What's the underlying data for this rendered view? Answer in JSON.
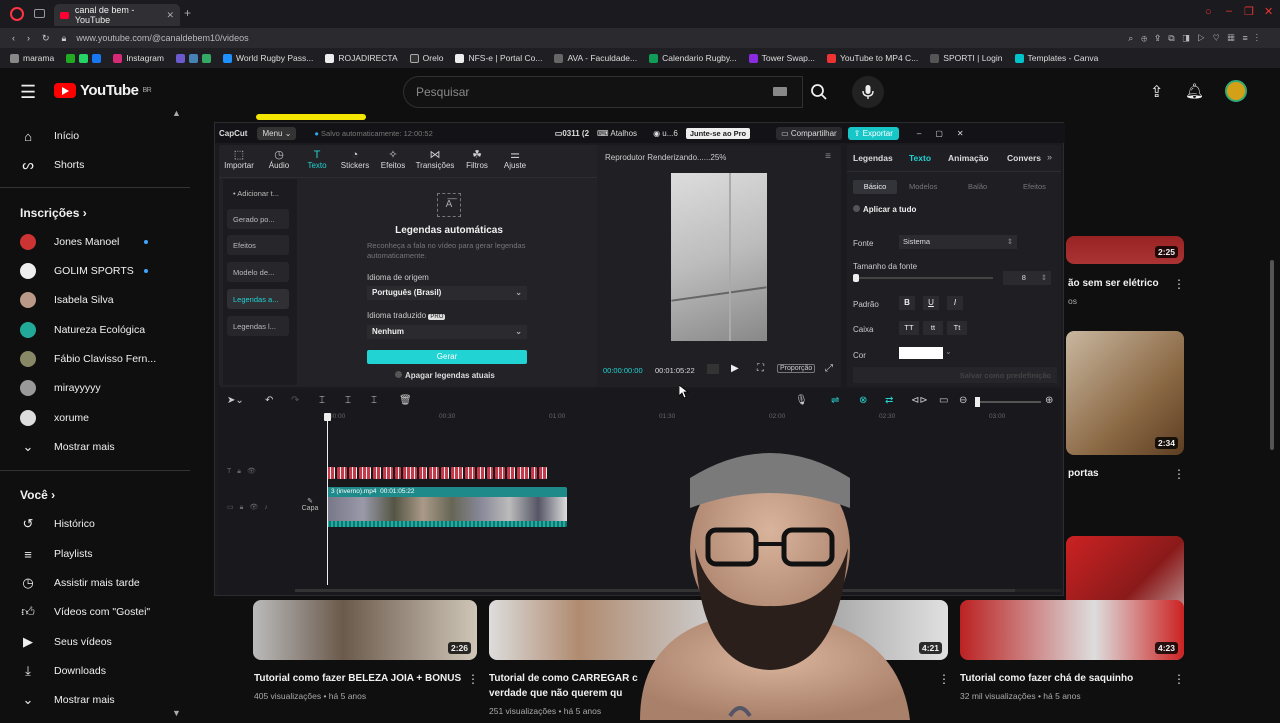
{
  "browser": {
    "tab_title": "canal de bem - YouTube",
    "url": "www.youtube.com/@canaldebem10/videos",
    "bookmarks": [
      "marama",
      "Instagram",
      "World Rugby Pass...",
      "ROJADIRECTA",
      "Orelo",
      "NFS-e | Portal Co...",
      "AVA - Faculdade...",
      "Calendario Rugby...",
      "Tower Swap...",
      "YouTube to MP4 C...",
      "SPORTI | Login",
      "Templates - Canva"
    ]
  },
  "youtube": {
    "logo": "YouTube",
    "region": "BR",
    "search_placeholder": "Pesquisar",
    "nav": {
      "home": "Início",
      "shorts": "Shorts"
    },
    "subs_header": "Inscrições",
    "subs": [
      "Jones Manoel",
      "GOLIM SPORTS",
      "Isabela Silva",
      "Natureza Ecológica",
      "Fábio Clavisso Fern...",
      "mirayyyyy",
      "xorume",
      "Mostrar mais"
    ],
    "you_header": "Você",
    "you": [
      "Histórico",
      "Playlists",
      "Assistir mais tarde",
      "Vídeos com \"Gostei\"",
      "Seus vídeos",
      "Downloads",
      "Mostrar mais"
    ],
    "videos": [
      {
        "title": "Tutorial como fazer BELEZA JOIA + BONUS",
        "meta": "405 visualizações • há 5 anos",
        "duration": "2:26"
      },
      {
        "title": "Tutorial de como CARREGAR c",
        "title2": "verdade que não querem qu",
        "meta": "251 visualizações • há 5 anos",
        "duration": ""
      },
      {
        "title": "",
        "meta": "",
        "duration": "4:21"
      },
      {
        "title": "Tutorial como fazer chá de saquinho",
        "meta": "32 mil visualizações • há 5 anos",
        "duration": "4:23"
      },
      {
        "title": "ão sem ser elétrico",
        "meta": "os",
        "duration": "2:25"
      },
      {
        "title": "portas",
        "meta": "",
        "duration": "2:34"
      }
    ]
  },
  "capcut": {
    "app": "CapCut",
    "menu": "Menu",
    "autosave": "Salvo automaticamente: 12:00:52",
    "project": "0311 (2",
    "shortcuts": "Atalhos",
    "user": "u...6",
    "pro": "Junte-se ao Pro",
    "share": "Compartilhar",
    "export": "Exportar",
    "tools": [
      "Importar",
      "Áudio",
      "Texto",
      "Stickers",
      "Efeitos",
      "Transições",
      "Filtros",
      "Ajuste"
    ],
    "side": [
      "• Adicionar t...",
      "Gerado po...",
      "Efeitos",
      "Modelo de...",
      "Legendas a...",
      "Legendas l..."
    ],
    "captions": {
      "title": "Legendas automáticas",
      "desc": "Reconheça a fala no vídeo para gerar legendas automaticamente.",
      "source_label": "Idioma de origem",
      "source_value": "Português (Brasil)",
      "translated_label": "Idioma traduzido",
      "translated_value": "Nenhum",
      "generate": "Gerar",
      "clear": "Apagar legendas atuais",
      "pro_badge": "PRO"
    },
    "player": {
      "title": "Reprodutor Renderizando......25%",
      "current": "00:00:00:00",
      "total": "00:01:05:22",
      "ratio": "Proporção"
    },
    "right": {
      "tabs": [
        "Legendas",
        "Texto",
        "Animação",
        "Convers"
      ],
      "subtabs": [
        "Básico",
        "Modelos",
        "Balão",
        "Efeitos"
      ],
      "apply_all": "Aplicar a tudo",
      "font_label": "Fonte",
      "font_value": "Sistema",
      "size_label": "Tamanho da fonte",
      "size_value": "8",
      "style_label": "Padrão",
      "case_label": "Caixa",
      "color_label": "Cor",
      "save_default": "Salvar como predefinição",
      "bold": "B",
      "italic": "I",
      "underline": "U",
      "case_options": [
        "TT",
        "tt",
        "Tt"
      ]
    },
    "timeline": {
      "ticks": [
        "00:00",
        "00:30",
        "01:00",
        "01:30",
        "02:00",
        "02:30",
        "03:00"
      ],
      "clip_label": "3 (inverno).mp4",
      "clip_duration": "00:01:05:22",
      "cover": "Capa"
    }
  },
  "colors": {
    "youtube_red": "#ff0000",
    "capcut_accent": "#22d3d3",
    "export_btn": "#17c7c7",
    "caption_track": "#c33b4a",
    "video_track": "#1f8a8a"
  }
}
